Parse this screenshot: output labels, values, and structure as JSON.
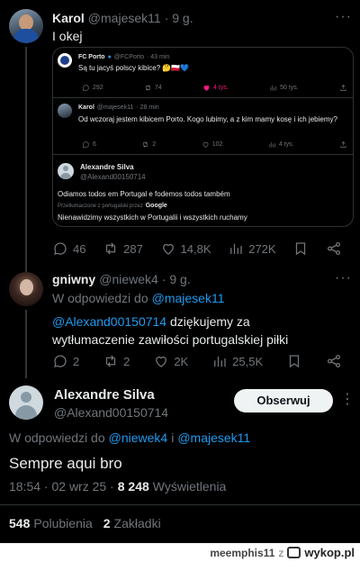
{
  "tweet1": {
    "author": "Karol",
    "handle": "@majesek11",
    "time": "· 9 g.",
    "text": "I okej",
    "quote": {
      "fcporto": {
        "author": "FC Porto",
        "handle": "@FCPorto",
        "time": "· 43 min",
        "text": "Są tu jacyś polscy kibice? 🤔🇵🇱💙",
        "stats": {
          "replies": "292",
          "retweets": "74",
          "likes": "4 tys.",
          "views": "50 tys."
        }
      },
      "karol_reply": {
        "author": "Karol",
        "handle": "@majesek11",
        "time": "· 28 min",
        "text": "Od wczoraj jestem kibicem Porto. Kogo lubimy, a z kim mamy kosę i ich jebiemy?",
        "stats": {
          "replies": "6",
          "retweets": "2",
          "likes": "102",
          "views": "4 tys."
        }
      },
      "silva": {
        "author": "Alexandre Silva",
        "handle": "@Alexand00150714",
        "text": "Odiamos todos em Portugal e fodemos todos também",
        "translated_label": "Przetłumaczone z portugalski przez",
        "translator": "Google",
        "translation": "Nienawidzimy wszystkich w Portugalii i wszystkich ruchamy"
      }
    },
    "stats": {
      "replies": "46",
      "retweets": "287",
      "likes": "14,8K",
      "views": "272K"
    }
  },
  "tweet2": {
    "author": "gniwny",
    "handle": "@niewek4",
    "time": "· 9 g.",
    "reply_prefix": "W odpowiedzi do",
    "reply_to": "@majesek11",
    "mention": "@Alexand00150714",
    "text_after_mention": " dziękujemy za",
    "text_line2": "wytłumaczenie zawiłości portugalskiej piłki",
    "stats": {
      "replies": "2",
      "retweets": "2",
      "likes": "2K",
      "views": "25,5K"
    }
  },
  "tweet3": {
    "author": "Alexandre Silva",
    "handle": "@Alexand00150714",
    "follow_label": "Obserwuj",
    "reply_prefix": "W odpowiedzi do",
    "reply_to_1": "@niewek4",
    "reply_and": "i",
    "reply_to_2": "@majesek11",
    "text": "Sempre aqui bro",
    "timestamp": "18:54 · 02 wrz 25 ·",
    "views_count": "8 248",
    "views_label": "Wyświetlenia",
    "likes_count": "548",
    "likes_label": "Polubienia",
    "bookmarks_count": "2",
    "bookmarks_label": "Zakładki"
  },
  "footer": {
    "user": "meemphis11",
    "separator": "z",
    "site": "wykop.pl"
  },
  "colors": {
    "background": "#000000",
    "accent_blue": "#1d9bf0",
    "muted": "#71767b",
    "like_pink": "#f91880"
  }
}
